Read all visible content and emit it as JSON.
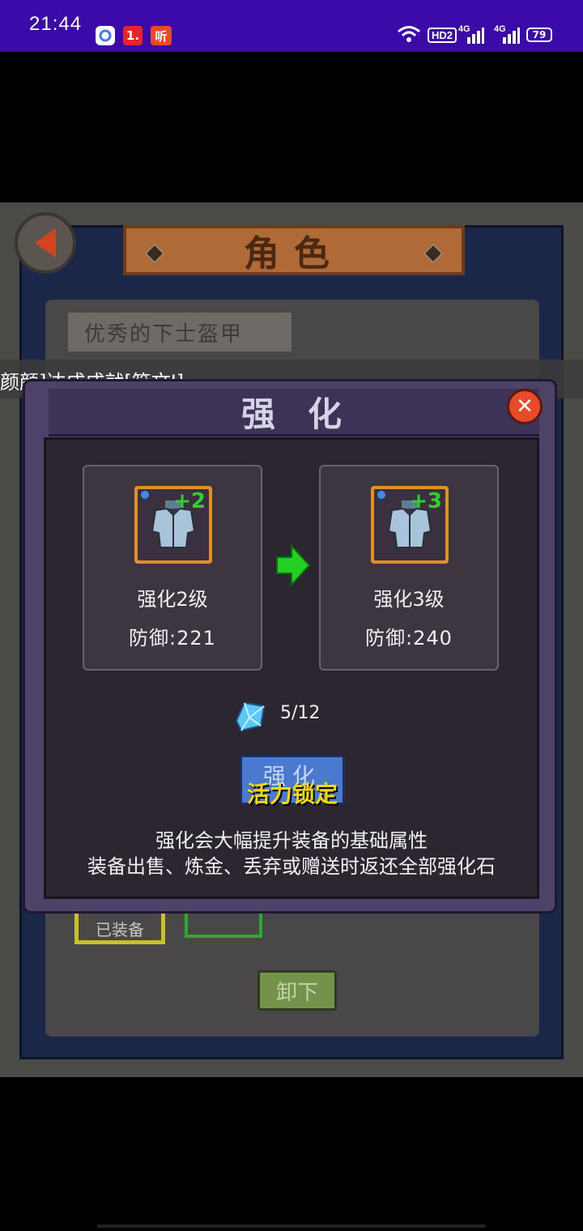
{
  "status_bar": {
    "time": "21:44",
    "app_badge_1": "1.",
    "app_badge_2": "听",
    "hd_label": "HD2",
    "signal_1": "4G",
    "signal_2": "4G",
    "battery": "79"
  },
  "background": {
    "screen_title": "角色",
    "item_name": "优秀的下士盔甲",
    "equipped_label": "已装备",
    "unequip_button": "卸下"
  },
  "notification": "颜颜]达成成就[符文Ⅰ]",
  "dialog": {
    "title": "强化",
    "current": {
      "level_label": "强化2级",
      "defense_label": "防御:221",
      "plus": "+2"
    },
    "next": {
      "level_label": "强化3级",
      "defense_label": "防御:240",
      "plus": "+3"
    },
    "stone_count": "5/12",
    "enhance_button": "强化",
    "lock_label": "活力锁定",
    "description_1": "强化会大幅提升装备的基础属性",
    "description_2": "装备出售、炼金、丢弃或赠送时返还全部强化石"
  },
  "colors": {
    "status_bar": "#3c0aa8",
    "dialog_frame": "#4f4268",
    "accent_green": "#2fd02f",
    "lock_yellow": "#f5d800",
    "close_red": "#e84a2a"
  }
}
